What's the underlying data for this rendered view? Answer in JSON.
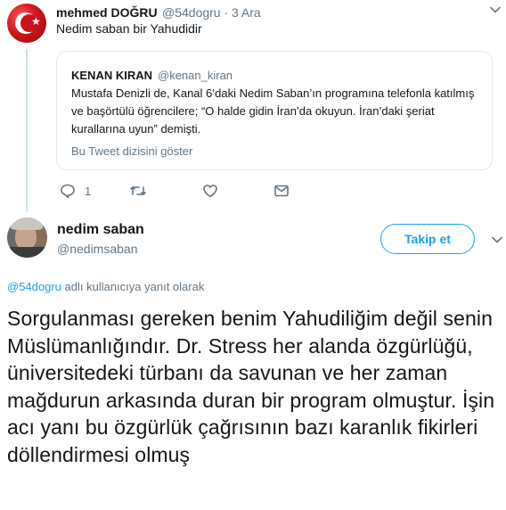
{
  "tweet1": {
    "display_name": "mehmed DOĞRU",
    "handle_time": "@54dogru · 3 Ara",
    "text": "Nedim saban bir Yahudidir",
    "quote": {
      "display_name": "KENAN KIRAN",
      "handle": "@kenan_kiran",
      "text": "Mustafa Denizli de, Kanal 6’daki Nedim Saban’ın programına telefonla katılmış ve başörtülü öğrencilere; “O halde gidin İran’da okuyun. İran’daki şeriat kurallarına uyun” demişti.",
      "thread_link": "Bu Tweet dizisini göster"
    },
    "actions": {
      "reply_count": "1",
      "reply_icon": "reply-icon",
      "retweet_icon": "retweet-icon",
      "like_icon": "heart-icon",
      "dm_icon": "envelope-icon"
    }
  },
  "tweet2": {
    "display_name": "nedim saban",
    "handle": "@nedimsaban",
    "follow_label": "Takip et",
    "replying_to_mention": "@54dogru",
    "replying_to_suffix": " adlı kullanıcıya yanıt olarak",
    "text": "Sorgulanması gereken benim Yahudiliğim değil senin Müslümanlığındır. Dr. Stress her alanda özgürlüğü, üniversitedeki türbanı da savunan ve her zaman mağdurun arkasında duran bir program olmuştur. İşin acı yanı bu özgürlük çağrısının bazı karanlık fikirleri döllendirmesi olmuş"
  },
  "colors": {
    "accent": "#1da1f2",
    "secondary_text": "#657786",
    "border": "#e1e8ed",
    "thread_line": "#cfe3f0"
  }
}
